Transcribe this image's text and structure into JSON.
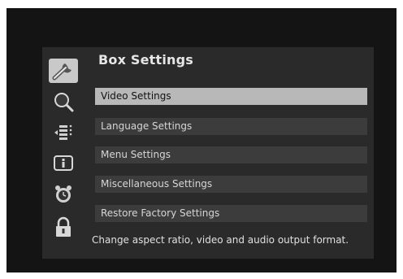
{
  "header": {
    "title": "Box Settings"
  },
  "sidebar": {
    "icons": [
      {
        "name": "settings-wrench-icon",
        "selected": true
      },
      {
        "name": "search-magnifier-icon",
        "selected": false
      },
      {
        "name": "channel-list-icon",
        "selected": false
      },
      {
        "name": "info-icon",
        "selected": false
      },
      {
        "name": "alarm-clock-icon",
        "selected": false
      },
      {
        "name": "lock-icon",
        "selected": false
      }
    ]
  },
  "menu": {
    "items": [
      {
        "label": "Video Settings",
        "selected": true
      },
      {
        "label": "Language Settings",
        "selected": false
      },
      {
        "label": "Menu Settings",
        "selected": false
      },
      {
        "label": "Miscellaneous Settings",
        "selected": false
      },
      {
        "label": "Restore Factory Settings",
        "selected": false
      }
    ]
  },
  "help_text": "Change aspect ratio, video and audio output format.",
  "colors": {
    "background": "#141414",
    "panel": "#2a2a2a",
    "item": "#3c3c3c",
    "item_selected": "#b8b8b8",
    "icon_selected": "#c9c9c9"
  }
}
